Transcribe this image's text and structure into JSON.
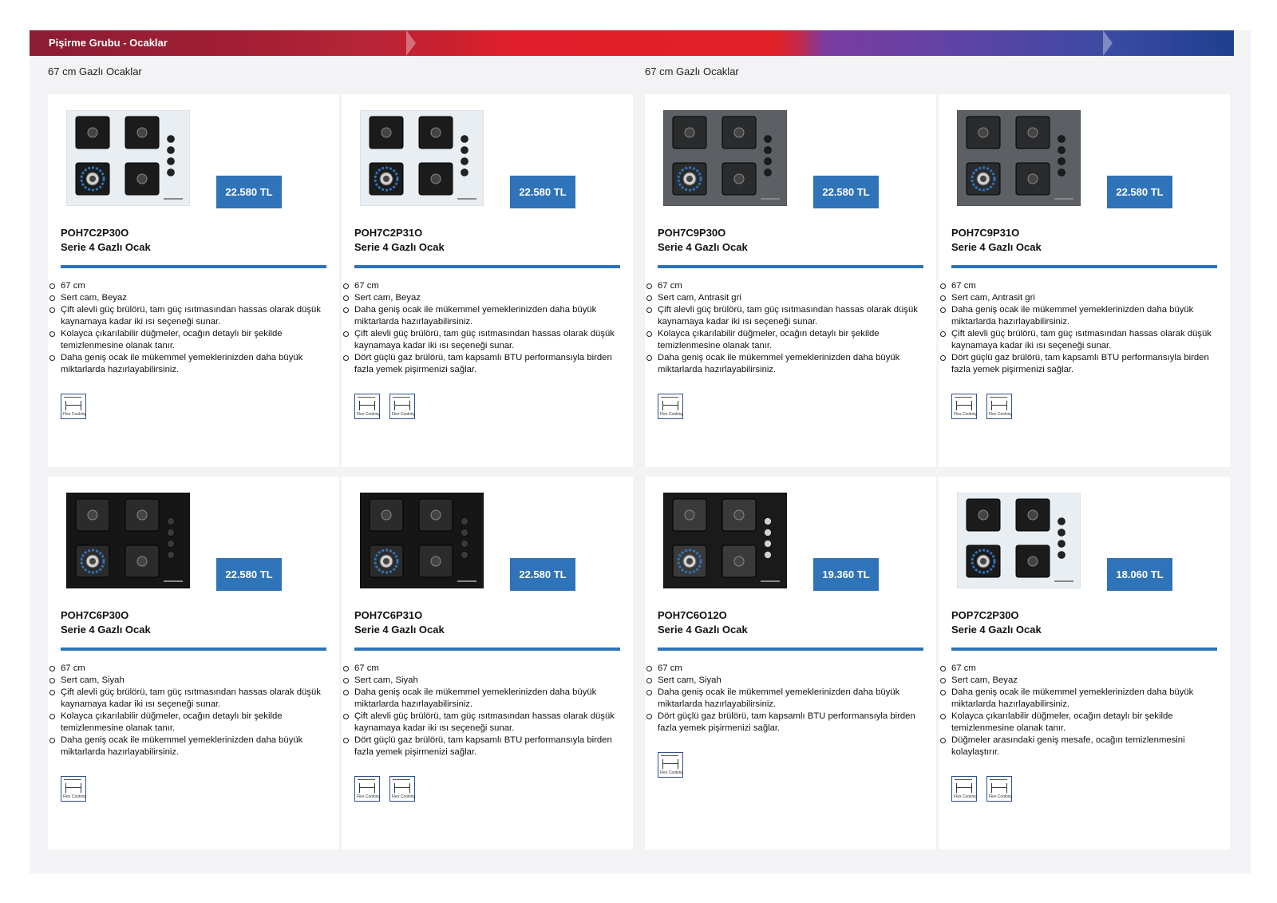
{
  "header": {
    "title": "Pişirme Grubu - Ocaklar"
  },
  "sections": [
    {
      "label": "67 cm Gazlı Ocaklar"
    },
    {
      "label": "67 cm Gazlı Ocaklar"
    }
  ],
  "colors": {
    "accent": "#2f73b8",
    "band_red": "#e01f2a",
    "band_blue": "#1f3f8f"
  },
  "products": [
    {
      "price": "22.580 TL",
      "model": "POH7C2P30O",
      "series": "Serie 4 Gazlı Ocak",
      "glass": "white",
      "features": [
        "67 cm",
        "Sert cam, Beyaz",
        "Çift alevli güç brülörü, tam güç ısıtmasından hassas olarak düşük kaynamaya kadar iki ısı seçeneği sunar.",
        "Kolayca çıkarılabilir düğmeler, ocağın detaylı bir şekilde temizlenmesine olanak tanır.",
        "Daha geniş ocak ile mükemmel yemeklerinizden daha büyük miktarlarda hazırlayabilirsiniz."
      ],
      "badges": [
        "Flex Cooking"
      ]
    },
    {
      "price": "22.580 TL",
      "model": "POH7C2P31O",
      "series": "Serie 4 Gazlı Ocak",
      "glass": "white",
      "features": [
        "67 cm",
        "Sert cam, Beyaz",
        "Daha geniş ocak ile mükemmel yemeklerinizden daha büyük miktarlarda hazırlayabilirsiniz.",
        "Çift alevli güç brülörü, tam güç ısıtmasından hassas olarak düşük kaynamaya kadar iki ısı seçeneği sunar.",
        "Dört güçlü gaz brülörü, tam kapsamlı BTU performansıyla birden fazla yemek pişirmenizi sağlar."
      ],
      "badges": [
        "Flex Cooking",
        "Flex Cooking"
      ]
    },
    {
      "price": "22.580 TL",
      "model": "POH7C9P30O",
      "series": "Serie 4 Gazlı Ocak",
      "glass": "grey",
      "features": [
        "67 cm",
        "Sert cam, Antrasit gri",
        "Çift alevli güç brülörü, tam güç ısıtmasından hassas olarak düşük kaynamaya kadar iki ısı seçeneği sunar.",
        "Kolayca çıkarılabilir düğmeler, ocağın detaylı bir şekilde temizlenmesine olanak tanır.",
        "Daha geniş ocak ile mükemmel yemeklerinizden daha büyük miktarlarda hazırlayabilirsiniz."
      ],
      "badges": [
        "Flex Cooking"
      ]
    },
    {
      "price": "22.580 TL",
      "model": "POH7C9P31O",
      "series": "Serie 4 Gazlı Ocak",
      "glass": "grey",
      "features": [
        "67 cm",
        "Sert cam, Antrasit gri",
        "Daha geniş ocak ile mükemmel yemeklerinizden daha büyük miktarlarda hazırlayabilirsiniz.",
        "Çift alevli güç brülörü, tam güç ısıtmasından hassas olarak düşük kaynamaya kadar iki ısı seçeneği sunar.",
        "Dört güçlü gaz brülörü, tam kapsamlı BTU performansıyla birden fazla yemek pişirmenizi sağlar."
      ],
      "badges": [
        "Flex Cooking",
        "Flex Cooking"
      ]
    },
    {
      "price": "22.580 TL",
      "model": "POH7C6P30O",
      "series": "Serie 4 Gazlı Ocak",
      "glass": "black",
      "features": [
        "67 cm",
        "Sert cam, Siyah",
        "Çift alevli güç brülörü, tam güç ısıtmasından hassas olarak düşük kaynamaya kadar iki ısı seçeneği sunar.",
        "Kolayca çıkarılabilir düğmeler, ocağın detaylı bir şekilde temizlenmesine olanak tanır.",
        "Daha geniş ocak ile mükemmel yemeklerinizden daha büyük miktarlarda hazırlayabilirsiniz."
      ],
      "badges": [
        "Flex Cooking"
      ]
    },
    {
      "price": "22.580 TL",
      "model": "POH7C6P31O",
      "series": "Serie 4 Gazlı Ocak",
      "glass": "black",
      "features": [
        "67 cm",
        "Sert cam, Siyah",
        "Daha geniş ocak ile mükemmel yemeklerinizden daha büyük miktarlarda hazırlayabilirsiniz.",
        "Çift alevli güç brülörü, tam güç ısıtmasından hassas olarak düşük kaynamaya kadar iki ısı seçeneği sunar.",
        "Dört güçlü gaz brülörü, tam kapsamlı BTU performansıyla birden fazla yemek pişirmenizi sağlar."
      ],
      "badges": [
        "Flex Cooking",
        "Flex Cooking"
      ]
    },
    {
      "price": "19.360 TL",
      "model": "POH7C6O12O",
      "series": "Serie 4 Gazlı Ocak",
      "glass": "black-steel",
      "features": [
        "67 cm",
        "Sert cam, Siyah",
        "Daha geniş ocak ile mükemmel yemeklerinizden daha büyük miktarlarda hazırlayabilirsiniz.",
        "Dört güçlü gaz brülörü, tam kapsamlı BTU performansıyla birden fazla yemek pişirmenizi sağlar."
      ],
      "badges": [
        "Flex Cooking"
      ]
    },
    {
      "price": "18.060 TL",
      "model": "POP7C2P30O",
      "series": "Serie 4 Gazlı Ocak",
      "glass": "white",
      "features": [
        "67 cm",
        "Sert cam, Beyaz",
        "Daha geniş ocak ile mükemmel yemeklerinizden daha büyük miktarlarda hazırlayabilirsiniz.",
        "Kolayca çıkarılabilir düğmeler, ocağın detaylı bir şekilde temizlenmesine olanak tanır.",
        "Düğmeler arasındaki geniş mesafe, ocağın temizlenmesini kolaylaştırır."
      ],
      "badges": [
        "Flex Cooking",
        "Flex Cooking"
      ]
    }
  ]
}
